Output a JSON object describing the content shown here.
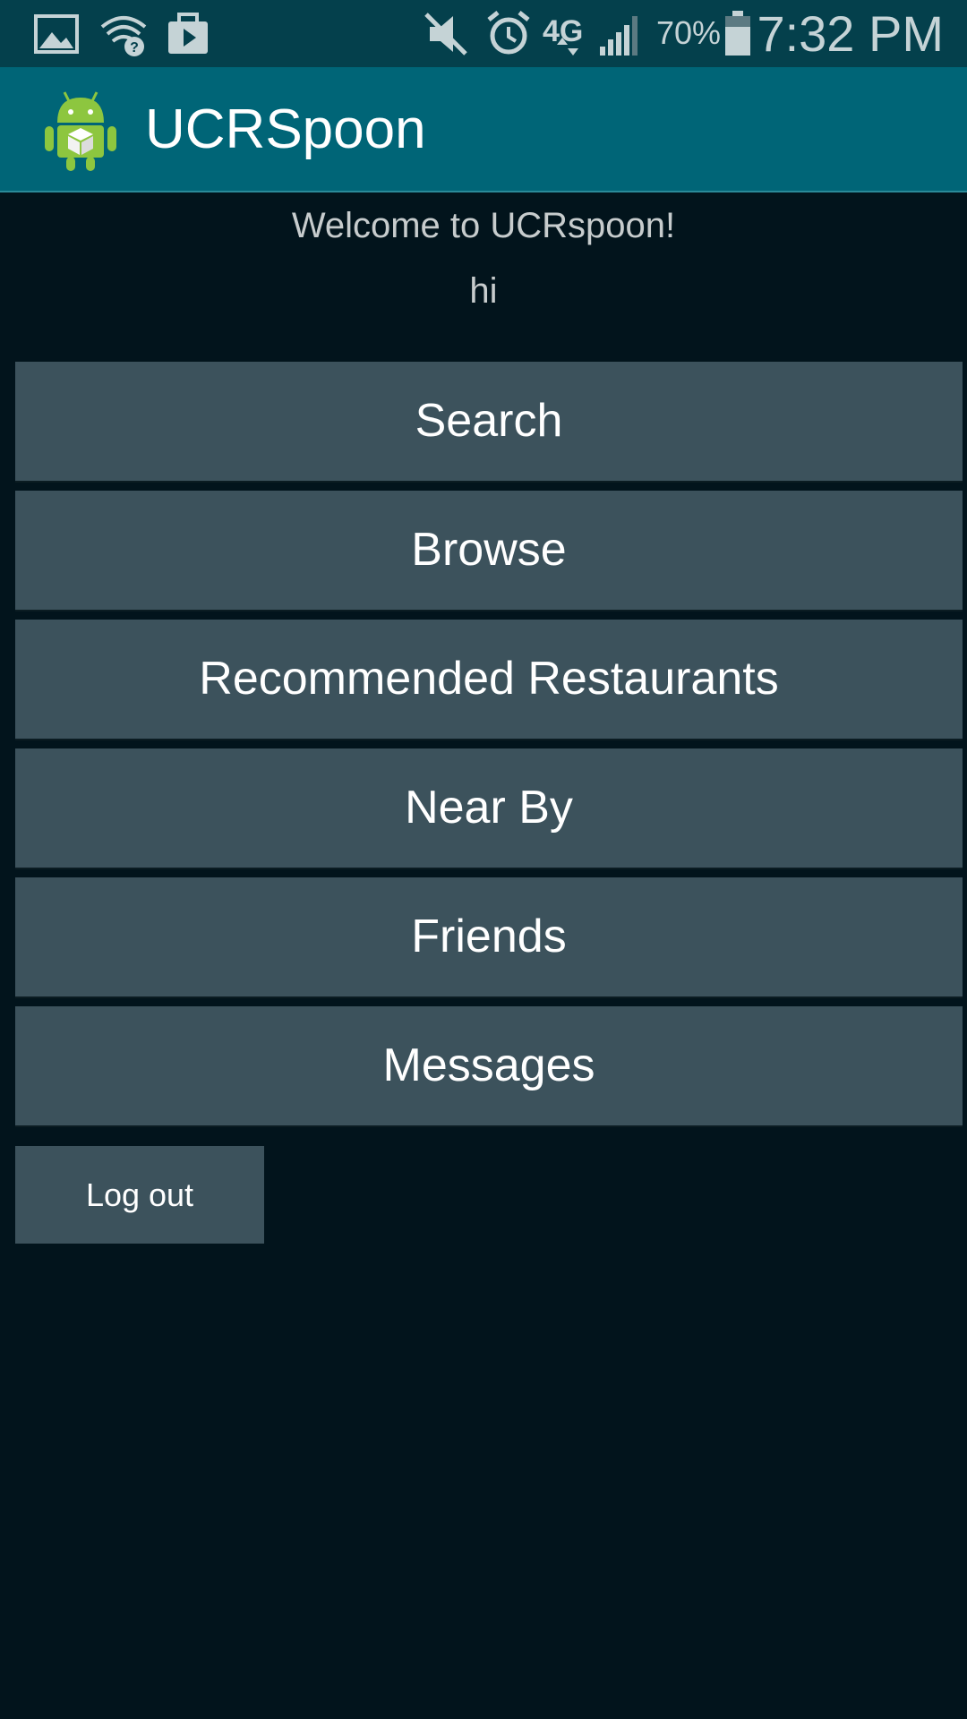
{
  "status_bar": {
    "icons": [
      "gallery-icon",
      "wifi-question-icon",
      "briefcase-icon",
      "mute-icon",
      "alarm-icon",
      "4g-lte-icon",
      "signal-icon",
      "battery-icon"
    ],
    "network_label": "4G",
    "battery_percent": "70%",
    "time": "7:32 PM"
  },
  "action_bar": {
    "title": "UCRSpoon",
    "icon": "android-app-icon"
  },
  "main": {
    "welcome_text": "Welcome to UCRspoon!",
    "greeting_text": "hi",
    "buttons": [
      {
        "label": "Search"
      },
      {
        "label": "Browse"
      },
      {
        "label": "Recommended Restaurants"
      },
      {
        "label": "Near By"
      },
      {
        "label": "Friends"
      },
      {
        "label": "Messages"
      }
    ],
    "logout_label": "Log out"
  },
  "colors": {
    "status_bar_bg": "#04404c",
    "action_bar_bg": "#006577",
    "page_bg": "#02141c",
    "button_bg": "#3c525c",
    "button_text": "#ffffff"
  }
}
